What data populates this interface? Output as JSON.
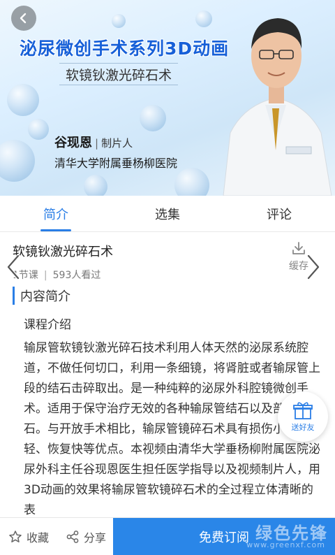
{
  "banner": {
    "title": "泌尿微创手术系列3D动画",
    "subtitle": "软镜钬激光碎石术",
    "producer_name": "谷现恩",
    "producer_role": "制片人",
    "hospital": "清华大学附属垂杨柳医院"
  },
  "tabs": [
    {
      "label": "简介",
      "active": true
    },
    {
      "label": "选集",
      "active": false
    },
    {
      "label": "评论",
      "active": false
    }
  ],
  "course": {
    "title": "软镜钬激光碎石术",
    "lessons": "1节课",
    "views": "593人看过",
    "cache_label": "缓存"
  },
  "content": {
    "section_title": "内容简介",
    "subheading": "课程介绍",
    "body": "输尿管软镜钬激光碎石技术利用人体天然的泌尿系统腔道，不做任何切口，利用一条细镜，将肾脏或者输尿管上段的结石击碎取出。是一种纯粹的泌尿外科腔镜微创手术。适用于保守治疗无效的各种输尿管结石以及部分肾结石。与开放手术相比，输尿管镜碎石术具有损伤小、痛苦轻、恢复快等优点。本视频由清华大学垂杨柳附属医院泌尿外科主任谷现恩医生担任医学指导以及视频制片人，用3D动画的效果将输尿管软镜碎石术的全过程立体清晰的表"
  },
  "gift": {
    "label": "送好友"
  },
  "bottom": {
    "favorite_label": "收藏",
    "share_label": "分享",
    "subscribe_label": "免费订阅",
    "watermark": "绿色先锋",
    "watermark_url": "www.greenxf.com"
  },
  "colors": {
    "accent": "#2a7ee6",
    "subscribe_bg": "#2a86e8"
  },
  "icons": [
    "back-arrow-icon",
    "download-icon",
    "chevron-left-icon",
    "chevron-right-icon",
    "gift-icon",
    "star-icon",
    "share-icon"
  ]
}
